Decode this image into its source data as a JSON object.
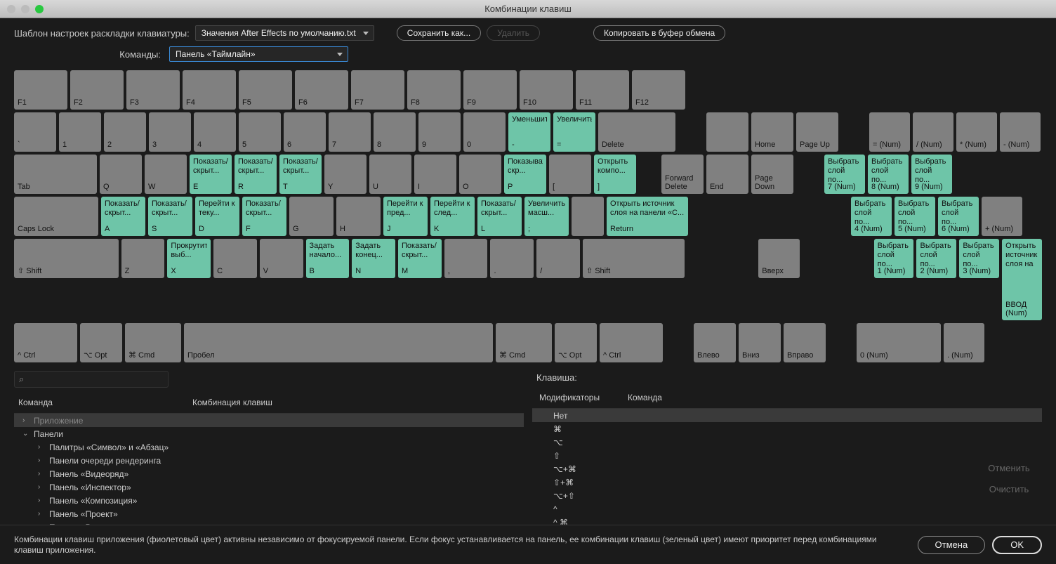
{
  "title": "Комбинации клавиш",
  "toolbar": {
    "layout_label": "Шаблон настроек раскладки клавиатуры:",
    "layout_value": "Значения After Effects по умолчанию.txt",
    "save_as": "Сохранить как...",
    "delete": "Удалить",
    "copy_clipboard": "Копировать в буфер обмена",
    "commands_label": "Команды:",
    "commands_value": "Панель «Таймлайн»"
  },
  "keys": {
    "frow": [
      "F1",
      "F2",
      "F3",
      "F4",
      "F5",
      "F6",
      "F7",
      "F8",
      "F9",
      "F10",
      "F11",
      "F12"
    ],
    "numrow_labels": [
      "`",
      "1",
      "2",
      "3",
      "4",
      "5",
      "6",
      "7",
      "8",
      "9",
      "0",
      "-",
      "=",
      "Delete"
    ],
    "numrow_actions": [
      "",
      "",
      "",
      "",
      "",
      "",
      "",
      "",
      "",
      "",
      "",
      "Уменьшить",
      "Увеличить",
      ""
    ],
    "qrow_labels": [
      "Tab",
      "Q",
      "W",
      "E",
      "R",
      "T",
      "Y",
      "U",
      "I",
      "O",
      "P",
      "[",
      "]"
    ],
    "qrow_actions": [
      "",
      "",
      "",
      "Показать/скрыт...",
      "Показать/скрыт...",
      "Показать/скрыт...",
      "",
      "",
      "",
      "",
      "Показывать/скр...",
      "",
      "Открыть компо..."
    ],
    "arow_labels": [
      "Caps Lock",
      "A",
      "S",
      "D",
      "F",
      "G",
      "H",
      "J",
      "K",
      "L",
      ";",
      "",
      "Return"
    ],
    "arow_actions": [
      "",
      "Показать/скрыт...",
      "Показать/скрыт...",
      "Перейти к теку...",
      "Показать/скрыт...",
      "",
      "",
      "Перейти к пред...",
      "Перейти к след...",
      "Показать/скрыт...",
      "Увеличить масш...",
      "",
      "Открыть источник слоя на панели «С..."
    ],
    "zrow_labels": [
      "⇧ Shift",
      "Z",
      "X",
      "C",
      "V",
      "B",
      "N",
      "M",
      ",",
      ".",
      "/",
      "⇧ Shift"
    ],
    "zrow_actions": [
      "",
      "",
      "Прокрутить выб...",
      "",
      "",
      "Задать начало...",
      "Задать конец...",
      "Показать/скрыт...",
      "",
      "",
      "",
      ""
    ],
    "bottomrow": [
      "^ Ctrl",
      "⌥ Opt",
      "⌘ Cmd",
      "Пробел",
      "⌘ Cmd",
      "⌥ Opt",
      "^ Ctrl"
    ],
    "nav1": [
      "",
      "Home",
      "Page Up"
    ],
    "nav2": [
      "Forward Delete",
      "End",
      "Page Down"
    ],
    "arrows_up": "Вверх",
    "arrows": [
      "Влево",
      "Вниз",
      "Вправо"
    ],
    "numpad": [
      [
        {
          "l": "= (Num)",
          "a": ""
        },
        {
          "l": "/ (Num)",
          "a": ""
        },
        {
          "l": "* (Num)",
          "a": ""
        },
        {
          "l": "- (Num)",
          "a": ""
        }
      ],
      [
        {
          "l": "7 (Num)",
          "a": "Выбрать слой по..."
        },
        {
          "l": "8 (Num)",
          "a": "Выбрать слой по..."
        },
        {
          "l": "9 (Num)",
          "a": "Выбрать слой по..."
        }
      ],
      [
        {
          "l": "4 (Num)",
          "a": "Выбрать слой по..."
        },
        {
          "l": "5 (Num)",
          "a": "Выбрать слой по..."
        },
        {
          "l": "6 (Num)",
          "a": "Выбрать слой по..."
        },
        {
          "l": "+ (Num)",
          "a": ""
        }
      ],
      [
        {
          "l": "1 (Num)",
          "a": "Выбрать слой по..."
        },
        {
          "l": "2 (Num)",
          "a": "Выбрать слой по..."
        },
        {
          "l": "3 (Num)",
          "a": "Выбрать слой по..."
        }
      ],
      [
        {
          "l": "0 (Num)",
          "a": ""
        },
        {
          "l": ". (Num)",
          "a": ""
        }
      ]
    ],
    "numpad_enter": {
      "l": "ВВОД (Num)",
      "a": "Открыть источник слоя на панели «Слой»"
    }
  },
  "left": {
    "search_icon": "⌕",
    "col_command": "Команда",
    "col_shortcut": "Комбинация клавиш",
    "rows": [
      {
        "label": "Приложение",
        "arrow": "›",
        "selected": true,
        "child": false
      },
      {
        "label": "Панели",
        "arrow": "⌄",
        "child": false
      },
      {
        "label": "Палитры «Символ» и «Абзац»",
        "arrow": "›",
        "child": true
      },
      {
        "label": "Панели очереди рендеринга",
        "arrow": "›",
        "child": true
      },
      {
        "label": "Панель «Видеоряд»",
        "arrow": "›",
        "child": true
      },
      {
        "label": "Панель «Инспектор»",
        "arrow": "›",
        "child": true
      },
      {
        "label": "Панель «Композиция»",
        "arrow": "›",
        "child": true
      },
      {
        "label": "Панель «Проект»",
        "arrow": "›",
        "child": true
      },
      {
        "label": "Панель «Рисование»",
        "arrow": "›",
        "child": true
      }
    ]
  },
  "right": {
    "key_label": "Клавиша:",
    "col_mod": "Модификаторы",
    "col_cmd": "Команда",
    "rows": [
      "Нет",
      "⌘",
      "⌥",
      "⇧",
      "⌥+⌘",
      "⇧+⌘",
      "⌥+⇧",
      "^",
      "^ ⌘"
    ],
    "undo": "Отменить",
    "clear": "Очистить"
  },
  "footer": {
    "hint": "Комбинации клавиш приложения (фиолетовый цвет) активны независимо от фокусируемой панели. Если фокус устанавливается на панель, ее комбинации клавиш (зеленый цвет) имеют приоритет перед комбинациями клавиш приложения.",
    "cancel": "Отмена",
    "ok": "OK"
  }
}
